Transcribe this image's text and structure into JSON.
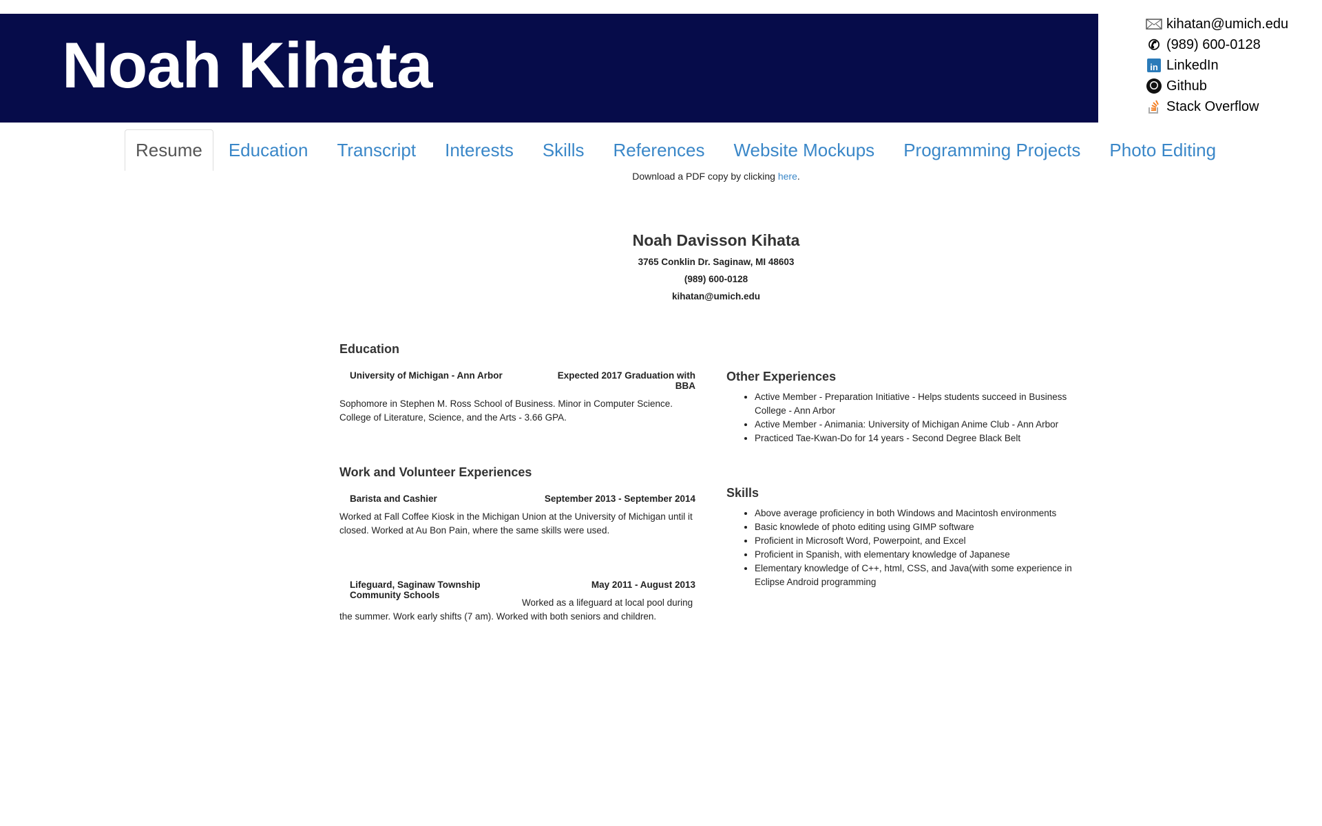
{
  "header": {
    "name": "Noah Kihata"
  },
  "contacts": [
    {
      "icon": "mail-icon",
      "label": "kihatan@umich.edu"
    },
    {
      "icon": "phone-icon",
      "label": "(989) 600-0128"
    },
    {
      "icon": "linkedin-icon",
      "label": "LinkedIn"
    },
    {
      "icon": "github-icon",
      "label": "Github"
    },
    {
      "icon": "stackoverflow-icon",
      "label": "Stack Overflow"
    }
  ],
  "tabs": [
    "Resume",
    "Education",
    "Transcript",
    "Interests",
    "Skills",
    "References",
    "Website Mockups",
    "Programming Projects",
    "Photo Editing"
  ],
  "download": {
    "text": "Download a PDF copy by clicking ",
    "link": "here",
    "end": "."
  },
  "resume": {
    "name": "Noah Davisson Kihata",
    "address": "3765 Conklin Dr. Saginaw, MI 48603",
    "phone": "(989) 600-0128",
    "email": "kihatan@umich.edu",
    "education": {
      "heading": "Education",
      "school": "University of Michigan - Ann Arbor",
      "date": "Expected 2017 Graduation with BBA",
      "desc": "Sophomore in Stephen M. Ross School of Business. Minor in Computer Science. College of Literature, Science, and the Arts - 3.66 GPA."
    },
    "work": {
      "heading": "Work and Volunteer Experiences",
      "jobs": [
        {
          "title": "Barista and Cashier",
          "date": "September 2013 - September 2014",
          "desc": "Worked at Fall Coffee Kiosk in the Michigan Union at the University of Michigan until it closed. Worked at Au Bon Pain, where the same skills were used."
        },
        {
          "title": "Lifeguard, Saginaw Township Community Schools",
          "date": "May 2011 - August 2013",
          "desc": "Worked as a lifeguard at local pool during the summer. Work early shifts (7 am). Worked with both seniors and children."
        }
      ]
    },
    "other": {
      "heading": "Other Experiences",
      "items": [
        "Active Member - Preparation Initiative - Helps students succeed in Business College - Ann Arbor",
        "Active Member - Animania: University of Michigan Anime Club - Ann Arbor",
        "Practiced Tae-Kwan-Do for 14 years - Second Degree Black Belt"
      ]
    },
    "skills": {
      "heading": "Skills",
      "items": [
        "Above average proficiency in both Windows and Macintosh environments",
        "Basic knowlede of photo editing using GIMP software",
        "Proficient in Microsoft Word, Powerpoint, and Excel",
        "Proficient in Spanish, with elementary knowledge of Japanese",
        "Elementary knowledge of C++, html, CSS, and Java(with some experience in Eclipse Android programming"
      ]
    }
  }
}
